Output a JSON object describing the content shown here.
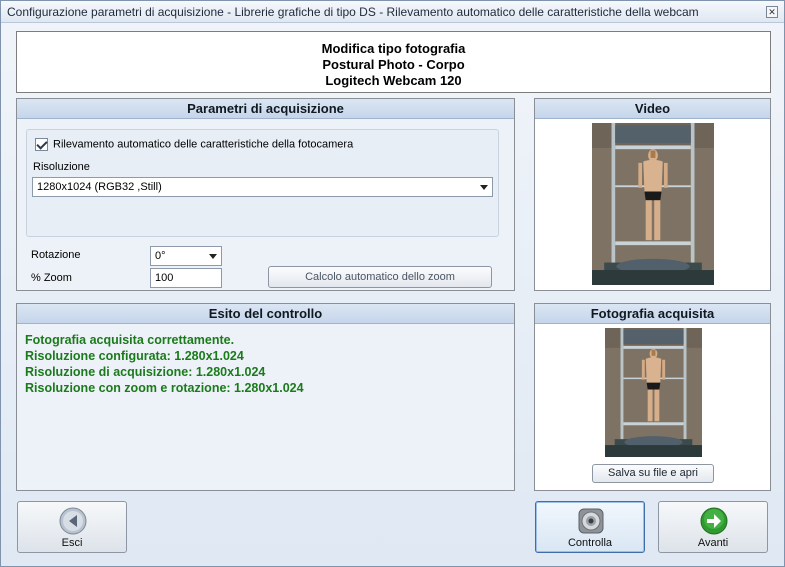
{
  "window": {
    "title": "Configurazione parametri di acquisizione - Librerie grafiche di tipo DS - Rilevamento automatico delle caratteristiche della webcam",
    "close_glyph": "✕"
  },
  "header": {
    "line1": "Modifica tipo fotografia",
    "line2": "Postural Photo - Corpo",
    "line3": "Logitech Webcam 120"
  },
  "params": {
    "title": "Parametri di acquisizione",
    "auto_detect_label": "Rilevamento automatico delle caratteristiche della fotocamera",
    "auto_detect_checked": true,
    "resolution_label": "Risoluzione",
    "resolution_value": "1280x1024  (RGB32 ,Still)",
    "rotation_label": "Rotazione",
    "rotation_value": "0°",
    "zoom_label": "% Zoom",
    "zoom_value": "100",
    "calc_zoom_button": "Calcolo automatico dello zoom"
  },
  "video": {
    "title": "Video"
  },
  "esito": {
    "title": "Esito del controllo",
    "lines": [
      "Fotografia acquisita correttamente.",
      "Risoluzione configurata: 1.280x1.024",
      "Risoluzione di acquisizione: 1.280x1.024",
      "Risoluzione con zoom e rotazione: 1.280x1.024"
    ],
    "text_color": "#1b7a1b"
  },
  "foto": {
    "title": "Fotografia acquisita",
    "save_button": "Salva su file e apri"
  },
  "footer": {
    "esci_label": "Esci",
    "esci_icon": "back-arrow-icon",
    "controlla_label": "Controlla",
    "controlla_icon": "webcam-icon",
    "avanti_label": "Avanti",
    "avanti_icon": "forward-arrow-icon"
  }
}
